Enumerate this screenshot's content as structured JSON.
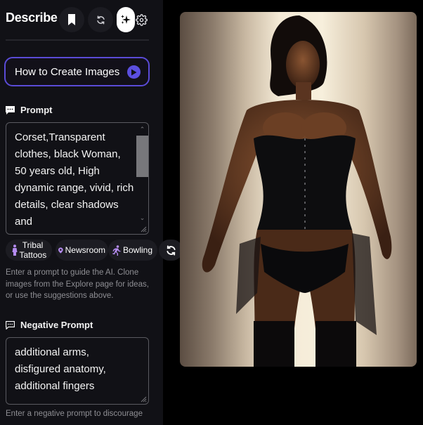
{
  "sidebar": {
    "title": "Describe",
    "header_buttons": [
      {
        "name": "bookmark",
        "icon": "bookmark-icon"
      },
      {
        "name": "refresh",
        "icon": "refresh-icon"
      },
      {
        "name": "sparkle",
        "icon": "sparkle-icon",
        "active": true
      },
      {
        "name": "settings",
        "icon": "gear-icon"
      }
    ],
    "how_to_button": {
      "label": "How to Create Images",
      "icon": "play-icon",
      "accent": "#5b4fe0"
    },
    "prompt": {
      "label": "Prompt",
      "icon": "chat-bubble-icon",
      "value": "Corset,Transparent clothes, black Woman, 50 years old, High dynamic range, vivid, rich details, clear shadows and",
      "help": "Enter a prompt to guide the AI. Clone images from the Explore page for ideas, or use the suggestions above."
    },
    "suggestions": [
      {
        "label": "Tribal Tattoos",
        "icon": "person-icon",
        "color": "#b58cf0"
      },
      {
        "label": "Newsroom",
        "icon": "map-pin-icon",
        "color": "#b58cf0"
      },
      {
        "label": "Bowling",
        "icon": "running-icon",
        "color": "#b58cf0"
      }
    ],
    "refresh_suggestions_icon": "refresh-icon",
    "negative_prompt": {
      "label": "Negative Prompt",
      "icon": "chat-bubble-icon",
      "value": "additional arms, disfigured anatomy, additional fingers",
      "help": "Enter a negative prompt to discourage"
    }
  },
  "main": {
    "image": {
      "alt": "Generated image: woman in black corset and garters against a lit beige backdrop"
    }
  }
}
